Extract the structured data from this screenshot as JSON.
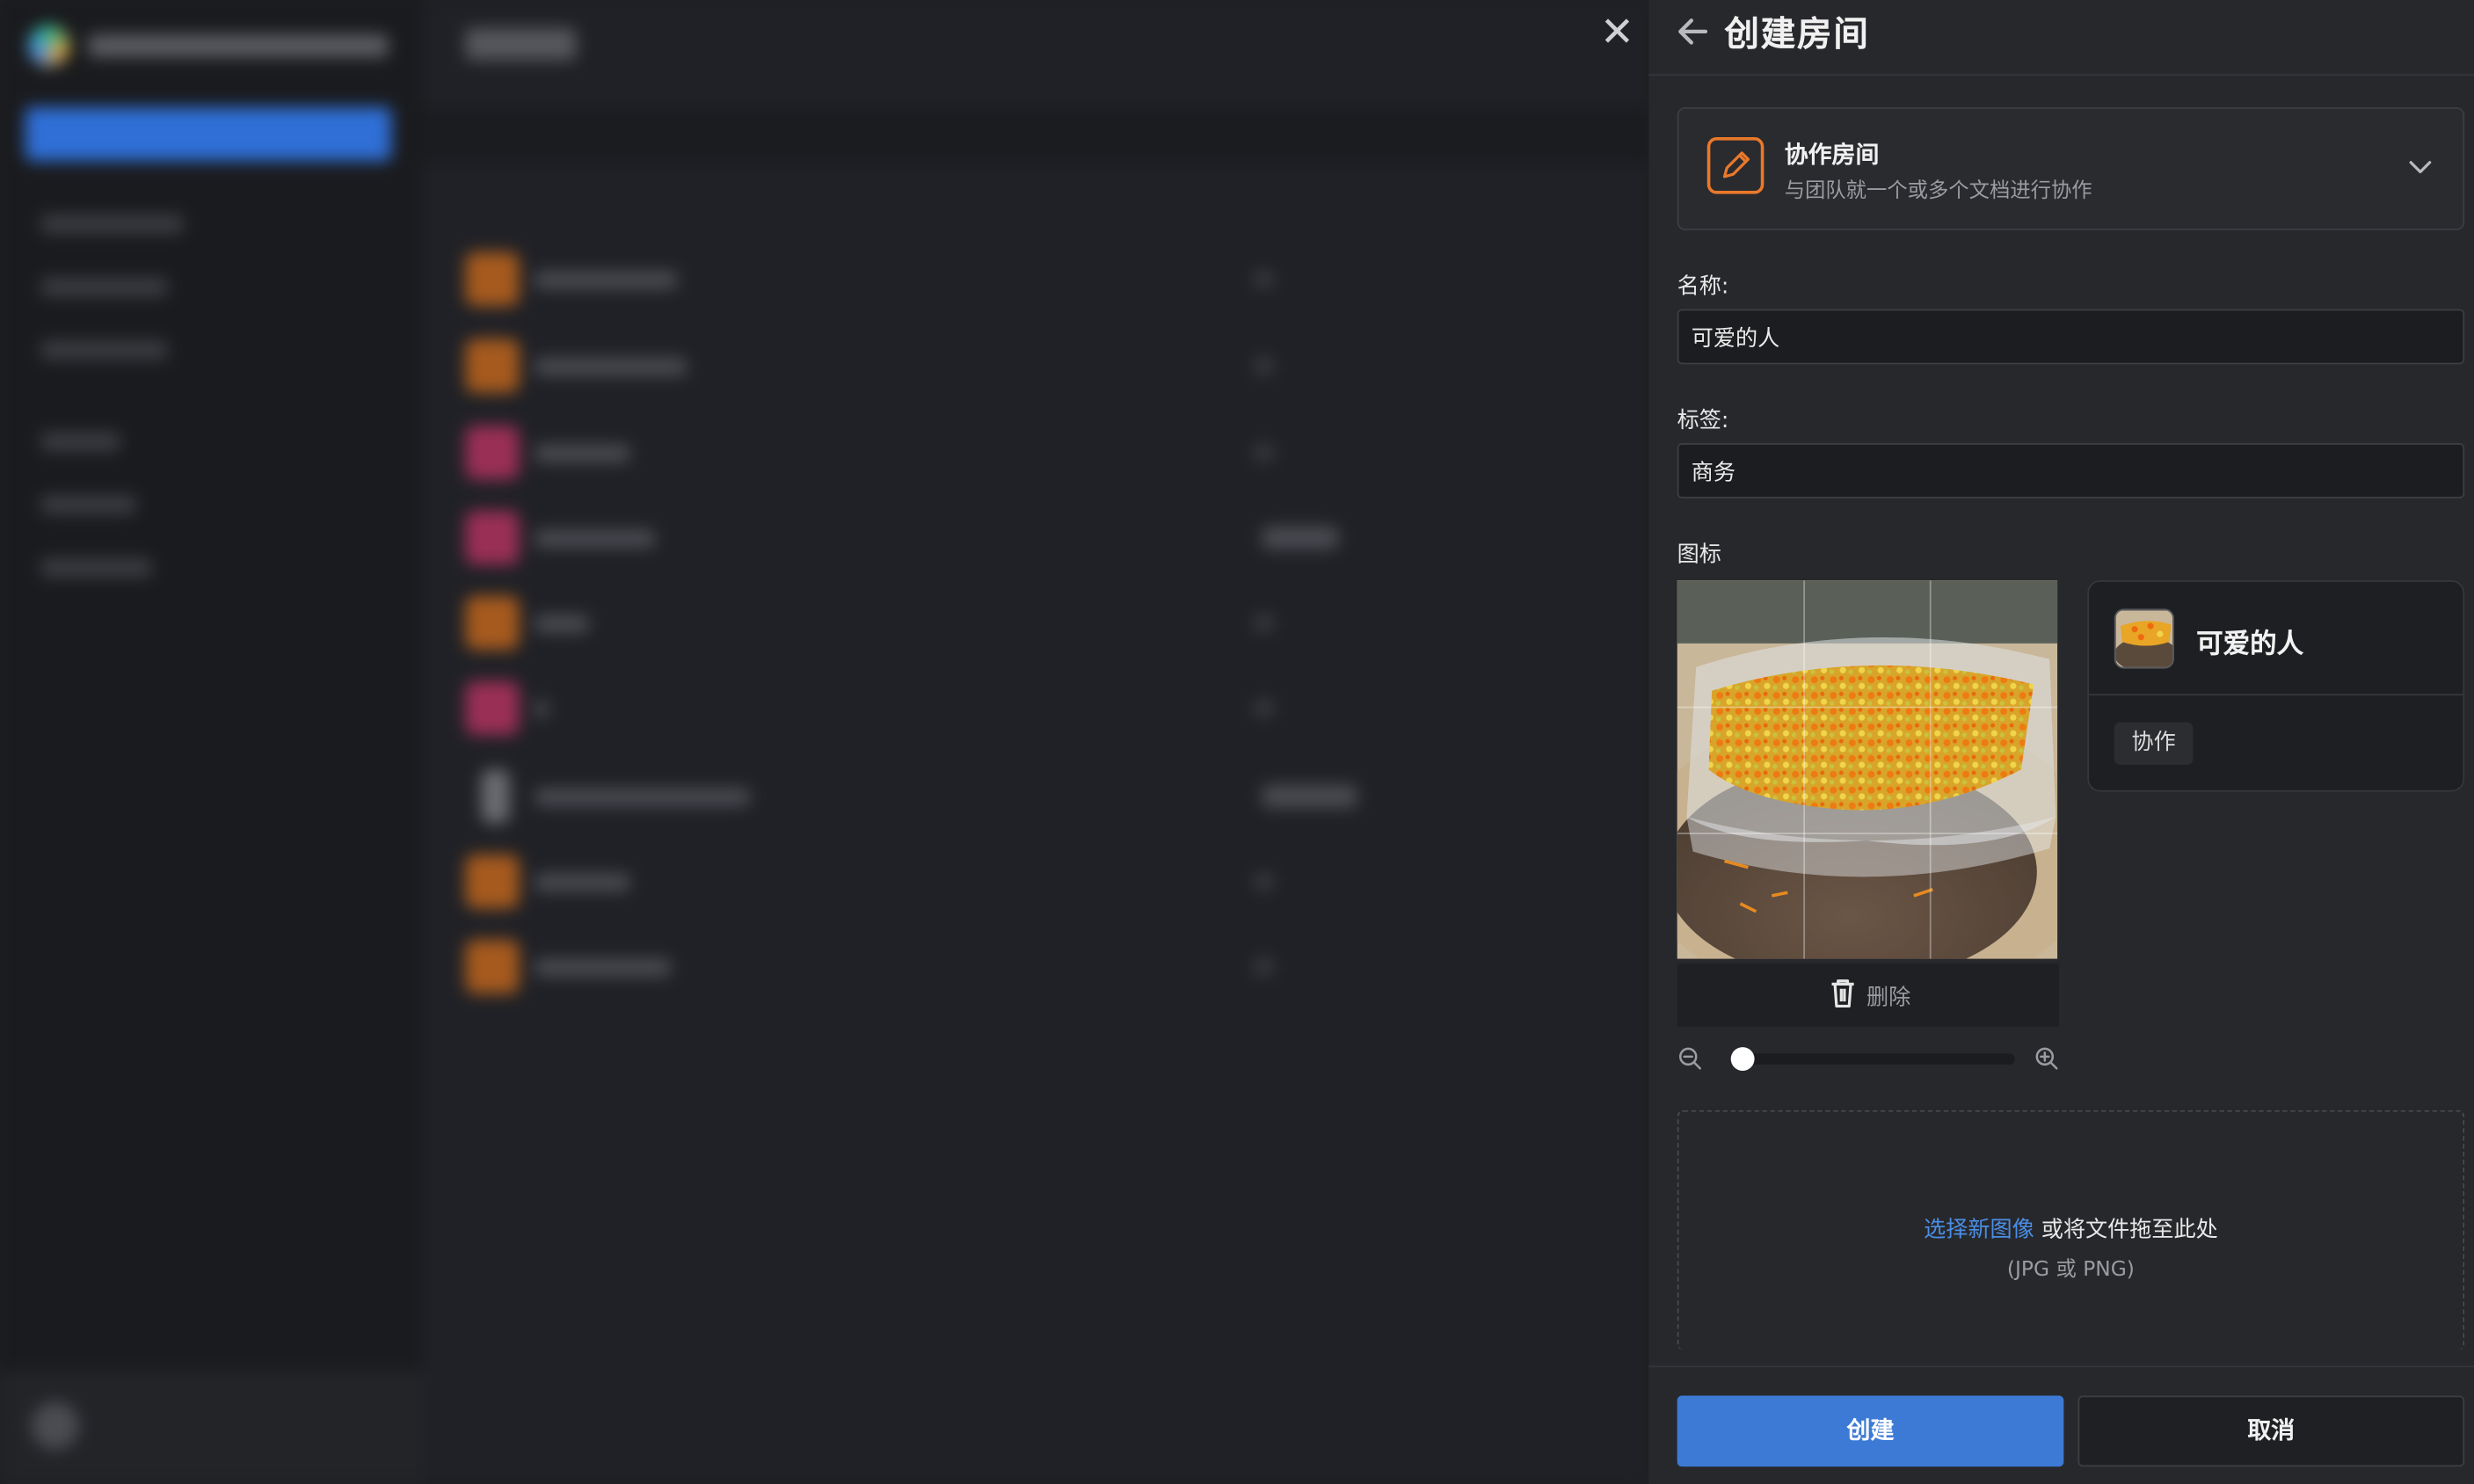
{
  "close_icon": "close-icon",
  "panel": {
    "title": "创建房间",
    "back_icon": "arrow-left-icon"
  },
  "room_type": {
    "name": "协作房间",
    "description": "与团队就一个或多个文档进行协作",
    "icon": "pencil-icon",
    "accent_color": "#e9792a"
  },
  "name_field": {
    "label": "名称:",
    "value": "可爱的人"
  },
  "tags_field": {
    "label": "标签:",
    "value": "商务"
  },
  "icon_section": {
    "label": "图标",
    "delete_label": "删除",
    "zoom_level": 0.0
  },
  "preview": {
    "name": "可爱的人",
    "tag": "协作"
  },
  "dropzone": {
    "link_text": "选择新图像",
    "text": "或将文件拖至此处",
    "hint": "(JPG 或 PNG)"
  },
  "footer": {
    "create_label": "创建",
    "cancel_label": "取消",
    "primary_color": "#3d7ad6"
  }
}
